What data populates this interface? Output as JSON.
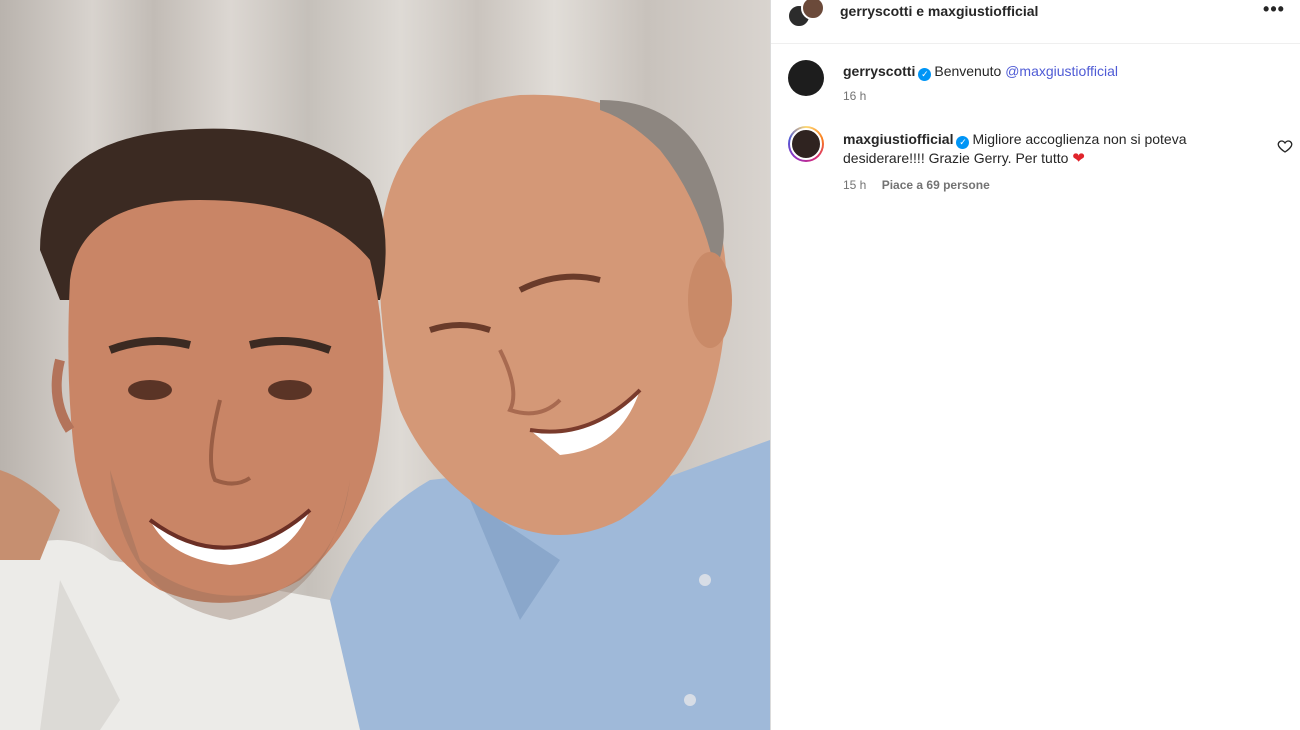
{
  "post": {
    "header_title": "gerryscotti e maxgiustiofficial",
    "more_icon": "more-horizontal-icon"
  },
  "comments": [
    {
      "username": "gerryscotti",
      "verified": true,
      "text": "Benvenuto ",
      "mention": "@maxgiustiofficial",
      "time": "16 h"
    },
    {
      "username": "maxgiustiofficial",
      "verified": true,
      "text": "Migliore accoglienza non si poteva desiderare!!!! Grazie Gerry. Per tutto ",
      "emoji": "❤",
      "time": "15 h",
      "likes": "Piace a 69 persone",
      "like_icon": "heart-outline-icon"
    }
  ],
  "colors": {
    "verified_blue": "#0095f6",
    "mention_color": "#4f5bd5",
    "meta_gray": "#737373",
    "heart_red": "#e0242b"
  }
}
